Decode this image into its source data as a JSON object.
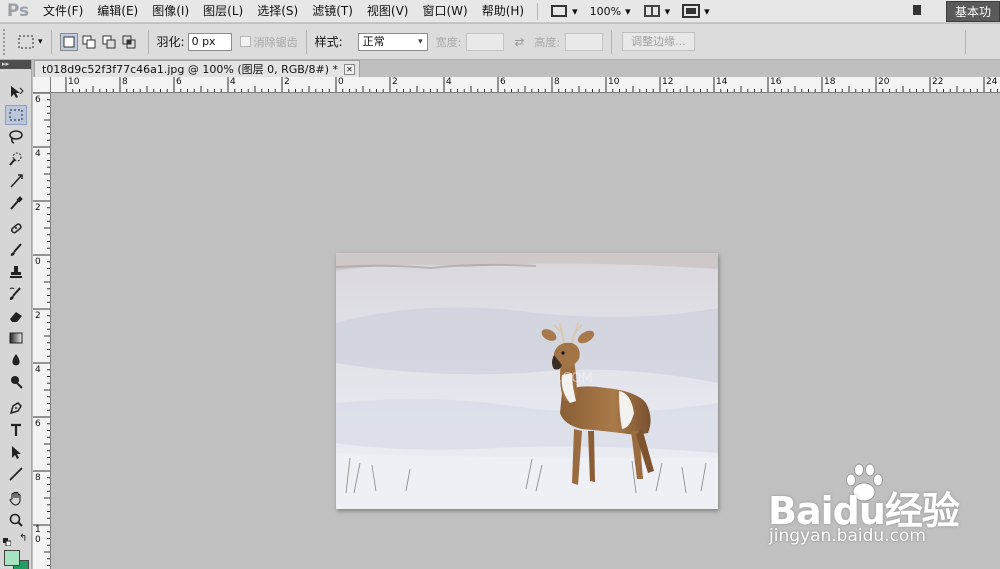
{
  "app": {
    "logo": "Ps",
    "menus": [
      "文件(F)",
      "编辑(E)",
      "图像(I)",
      "图层(L)",
      "选择(S)",
      "滤镜(T)",
      "视图(V)",
      "窗口(W)",
      "帮助(H)"
    ],
    "zoom": "100%",
    "workspace": "基本功"
  },
  "options": {
    "feather_label": "羽化:",
    "feather_value": "0 px",
    "antialias_label": "消除锯齿",
    "style_label": "样式:",
    "style_value": "正常",
    "width_label": "宽度:",
    "height_label": "高度:",
    "refine_label": "调整边缘..."
  },
  "document": {
    "tab_title": "t018d9c52f3f77c46a1.jpg @ 100% (图层 0, RGB/8#) *"
  },
  "rulers": {
    "horizontal": [
      "10",
      "8",
      "6",
      "4",
      "2",
      "0",
      "2",
      "4",
      "6",
      "8",
      "10",
      "12",
      "14",
      "16",
      "18",
      "20",
      "22",
      "24"
    ],
    "vertical": [
      "6",
      "4",
      "2",
      "0",
      "2",
      "4",
      "6",
      "8",
      "1",
      "0"
    ]
  },
  "watermark": {
    "brand": "Baidu经验",
    "url": "jingyan.baidu.com"
  },
  "colors": {
    "foreground": "#a7e3c0",
    "background": "#1f9e63",
    "workspace_bg": "#c0c0c0"
  },
  "icons": {
    "tools": [
      "move-icon",
      "rect-marquee-icon",
      "lasso-icon",
      "quick-select-icon",
      "crop-icon",
      "eyedropper-icon",
      "healing-brush-icon",
      "brush-icon",
      "clone-stamp-icon",
      "history-brush-icon",
      "eraser-icon",
      "gradient-icon",
      "blur-icon",
      "dodge-icon",
      "pen-icon",
      "type-icon",
      "path-select-icon",
      "line-icon",
      "hand-icon",
      "zoom-icon"
    ]
  }
}
